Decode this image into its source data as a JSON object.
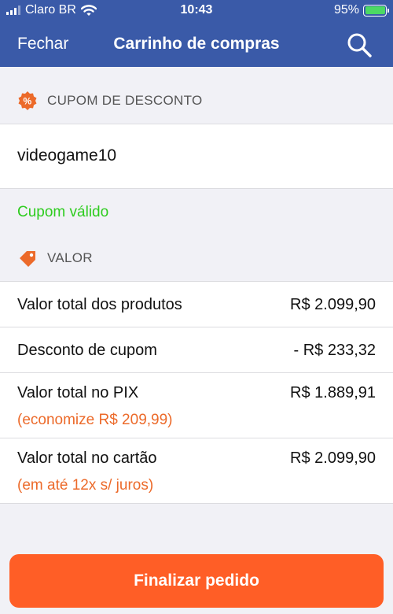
{
  "status_bar": {
    "carrier": "Claro BR",
    "time": "10:43",
    "battery": "95%"
  },
  "nav": {
    "close_label": "Fechar",
    "title": "Carrinho de compras",
    "search_icon": "search-icon"
  },
  "coupon_section": {
    "title": "CUPOM DE DESCONTO",
    "icon": "discount-badge-icon",
    "code": "videogame10",
    "status": "Cupom válido",
    "status_color": "#2ecc1f"
  },
  "value_section": {
    "title": "VALOR",
    "icon": "price-tag-icon",
    "rows": [
      {
        "label": "Valor total dos produtos",
        "value": "R$ 2.099,90"
      },
      {
        "label": "Desconto de cupom",
        "value": "- R$ 233,32"
      },
      {
        "label": "Valor total no PIX",
        "value": "R$ 1.889,91",
        "sub": "(economize R$ 209,99)"
      },
      {
        "label": "Valor total no cartão",
        "value": "R$ 2.099,90",
        "sub": "(em até 12x s/ juros)"
      }
    ]
  },
  "checkout": {
    "label": "Finalizar pedido"
  },
  "colors": {
    "header": "#3a5aa8",
    "accent": "#ff5e26",
    "highlight": "#ec6a2a"
  }
}
